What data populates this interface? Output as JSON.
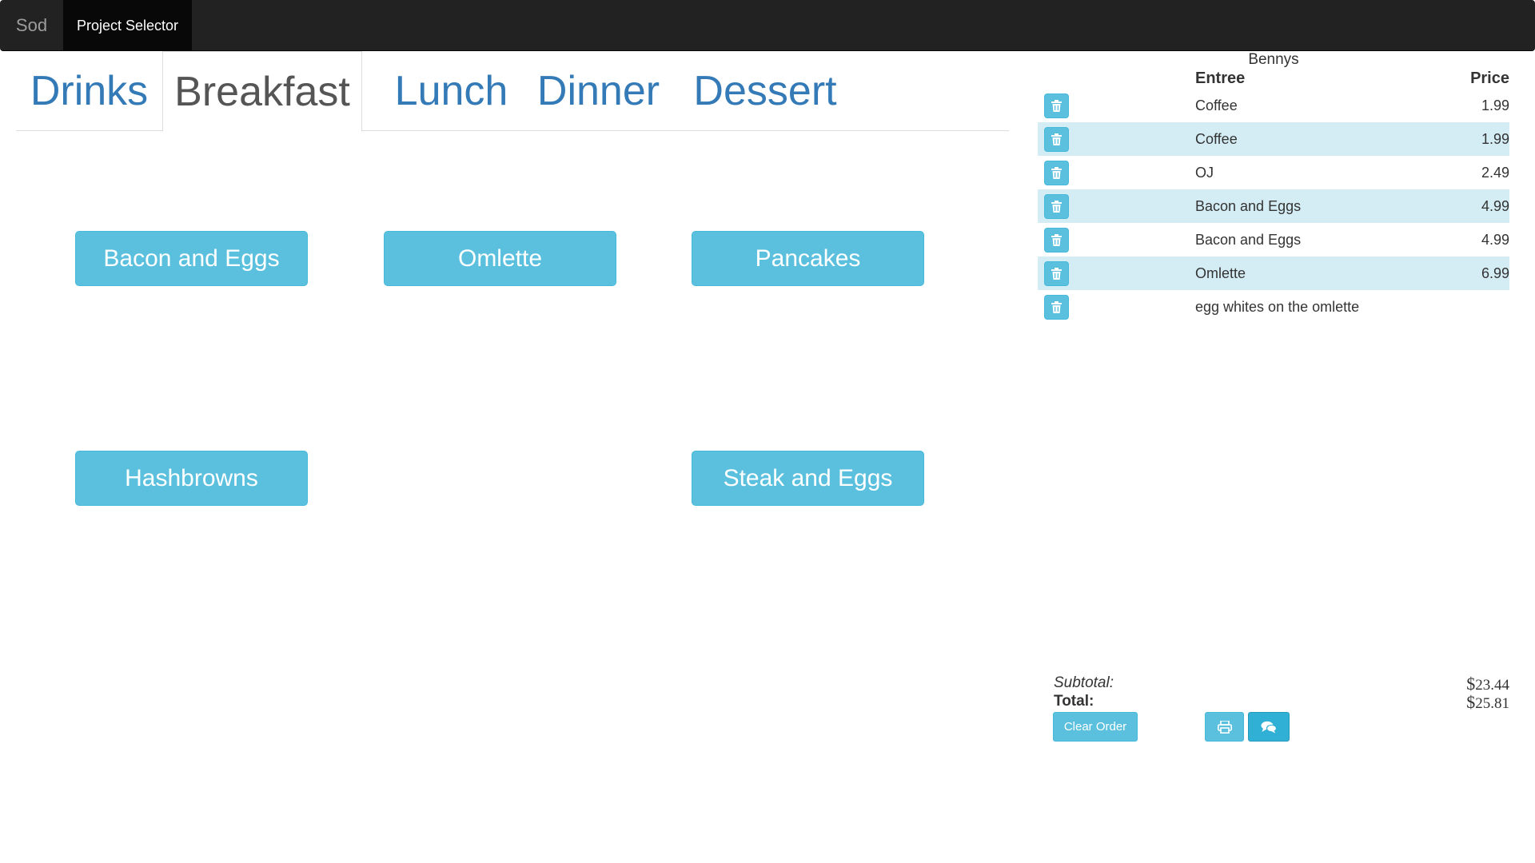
{
  "navbar": {
    "brand": "Sod",
    "active_item": "Project Selector"
  },
  "tabs": [
    {
      "label": "Drinks",
      "active": false
    },
    {
      "label": "Breakfast",
      "active": true
    },
    {
      "label": "Lunch",
      "active": false
    },
    {
      "label": "Dinner",
      "active": false
    },
    {
      "label": "Dessert",
      "active": false
    }
  ],
  "menu_items": [
    "Bacon and Eggs",
    "Omlette",
    "Pancakes",
    "Hashbrowns",
    "Steak and Eggs"
  ],
  "order": {
    "restaurant": "Bennys",
    "headers": {
      "entree": "Entree",
      "price": "Price"
    },
    "rows": [
      {
        "name": "Coffee",
        "price": "1.99"
      },
      {
        "name": "Coffee",
        "price": "1.99"
      },
      {
        "name": "OJ",
        "price": "2.49"
      },
      {
        "name": "Bacon and Eggs",
        "price": "4.99"
      },
      {
        "name": "Bacon and Eggs",
        "price": "4.99"
      },
      {
        "name": "Omlette",
        "price": "6.99"
      },
      {
        "name": "egg whites on the omlette",
        "price": ""
      }
    ],
    "subtotal_label": "Subtotal:",
    "subtotal_currency": "$",
    "subtotal_value": "23.44",
    "total_label": "Total:",
    "total_currency": "$",
    "total_value": "25.81",
    "clear_label": "Clear Order"
  },
  "icons": {
    "delete": "trash-icon",
    "print": "print-icon",
    "message": "comments-icon"
  },
  "colors": {
    "info": "#5bc0de",
    "link": "#337ab7",
    "navbar": "#222222",
    "stripe": "#d4edf5"
  }
}
